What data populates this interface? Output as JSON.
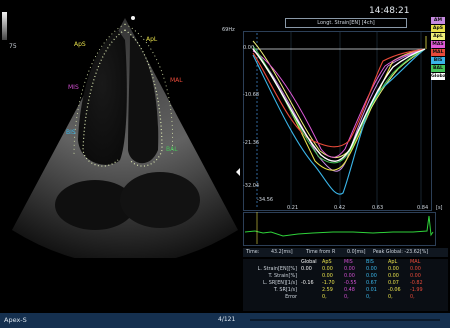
{
  "header": {
    "time": "14:48:21",
    "frame_rate": "69Hz",
    "plot_title": "Longt. Strain[EN] [4ch]"
  },
  "echo": {
    "gain_value": "75",
    "segment_labels": [
      "ApS",
      "ApL",
      "MIS",
      "MAL",
      "BIS",
      "BAL"
    ],
    "segment_colors": [
      "#e7e04b",
      "#e7e04b",
      "#d14fd0",
      "#e84a3a",
      "#3ab5e8",
      "#46c65a"
    ]
  },
  "strain_plot": {
    "y_ticks": [
      "0.00",
      "-10.68",
      "-21.36",
      "-32.04"
    ],
    "x_ticks": [
      "0.21",
      "0.42",
      "0.63",
      "0.84"
    ],
    "x_unit": "[s]",
    "bottom_left_label": "-34.56",
    "legend": [
      {
        "label": "AM",
        "color": "#c78be0"
      },
      {
        "label": "ApS",
        "color": "#e7e04b"
      },
      {
        "label": "ApL",
        "color": "#f0f07a"
      },
      {
        "label": "MAS",
        "color": "#e05ad8"
      },
      {
        "label": "MAL",
        "color": "#e84a3a"
      },
      {
        "label": "BIS",
        "color": "#3ab5e8"
      },
      {
        "label": "BAL",
        "color": "#46c65a"
      },
      {
        "label": "Global",
        "color": "#f4f4f4"
      }
    ]
  },
  "status_bar": {
    "time_label": "Time:",
    "time_value": "43.2[ms]",
    "time_from_r_label": "Time from R",
    "time_from_r_value": "0.0[ms]",
    "peak_global": "Peak Global: -23.62[%]"
  },
  "table": {
    "columns": [
      "",
      "Global",
      "ApS",
      "MIS",
      "BIS",
      "ApL",
      "MAL"
    ],
    "column_colors": [
      "#cfd6de",
      "#f4f4f4",
      "#e7e04b",
      "#d14fd0",
      "#3ab5e8",
      "#e7e04b",
      "#e84a3a"
    ],
    "rows": [
      {
        "label": "L. Strain[EN][%]",
        "values": [
          "0.00",
          "0.00",
          "0.00",
          "0.00",
          "0.00",
          "0.00"
        ]
      },
      {
        "label": "T. Strain[%]",
        "values": [
          "",
          "0.00",
          "0.00",
          "0.00",
          "0.00",
          "0.00"
        ]
      },
      {
        "label": "L. SR[EN][1/s]",
        "values": [
          "-0.16",
          "-1.70",
          "-0.55",
          "0.67",
          "0.07",
          "-0.82"
        ]
      },
      {
        "label": "T. SR[1/s]",
        "values": [
          "",
          "2.59",
          "0.48",
          "0.01",
          "-0.06",
          "-1.99"
        ]
      },
      {
        "label": "Error",
        "values": [
          "",
          "0,",
          "0,",
          "0,",
          "0,",
          "0,"
        ]
      }
    ]
  },
  "footer": {
    "view_name": "Apex-S",
    "frame_counter": "4/121"
  }
}
